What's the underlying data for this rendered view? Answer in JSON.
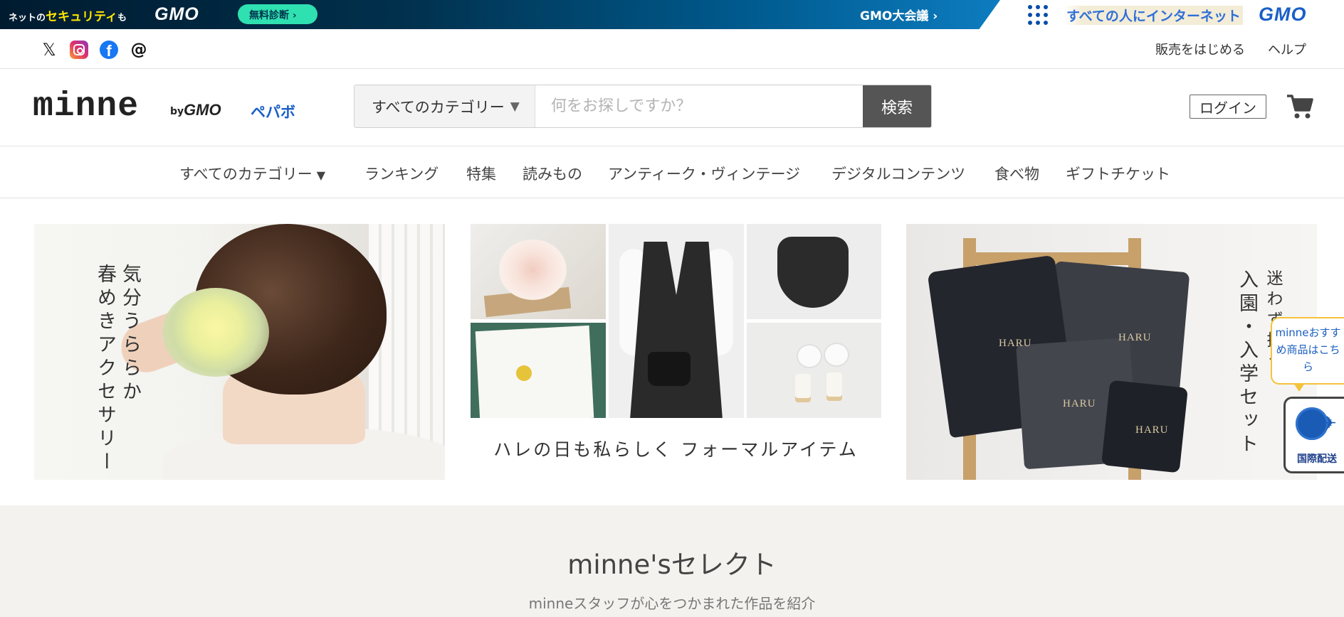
{
  "gmo_banner": {
    "security_prefix": "ネットの",
    "security_highlight": "セキュリティ",
    "security_suffix": "も",
    "logo_left": "GMO",
    "diagnosis_button": "無料診断 ›",
    "conference_link": "GMO大会議 ›",
    "tagline": "すべての人にインターネット",
    "logo_right": "GMO"
  },
  "util_bar": {
    "social_icons": [
      "x-icon",
      "instagram-icon",
      "facebook-icon",
      "threads-icon"
    ],
    "links": [
      "販売をはじめる",
      "ヘルプ"
    ]
  },
  "header": {
    "logo_text": "minne",
    "logo_by": "by",
    "logo_gmo": "GMO",
    "logo_pepabo": "ペパボ",
    "category_select": "すべてのカテゴリー",
    "search_placeholder": "何をお探しですか？",
    "search_button": "検索",
    "login_button": "ログイン"
  },
  "nav": {
    "items": [
      "すべてのカテゴリー",
      "ランキング",
      "特集",
      "読みもの",
      "アンティーク・ヴィンテージ",
      "デジタルコンテンツ",
      "食べ物",
      "ギフトチケット"
    ]
  },
  "banners": {
    "left_line1": "気分うららか",
    "left_line2": "春めきアクセサリー",
    "center_caption": "ハレの日も私らしく フォーマルアイテム",
    "right_line1": "迷わず揃う",
    "right_line2": "入園・入学セット",
    "bag_label": "HARU"
  },
  "floating": {
    "recommend_bubble": "minneおすすめ商品はこちら",
    "shipping_label": "国際配送"
  },
  "select_section": {
    "title": "minne'sセレクト",
    "subtitle": "minneスタッフが心をつかまれた作品を紹介"
  },
  "colors": {
    "search_button_bg": "#555555",
    "select_bg": "#f3f2ef",
    "accent_yellow": "#f4c23b"
  }
}
